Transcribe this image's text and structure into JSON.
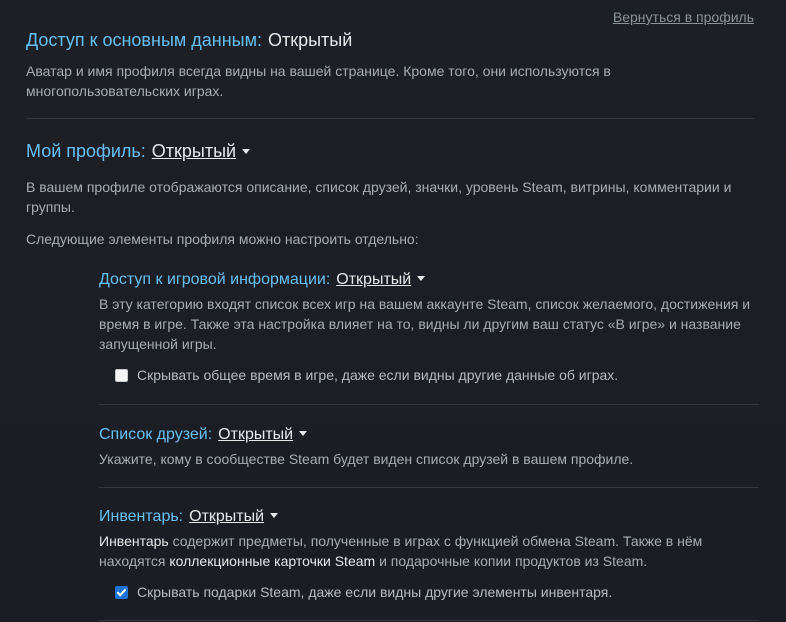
{
  "back_link": "Вернуться в профиль",
  "basic": {
    "label": "Доступ к основным данным:",
    "value": "Открытый",
    "desc": "Аватар и имя профиля всегда видны на вашей странице. Кроме того, они используются в многопользовательских играх."
  },
  "profile": {
    "label": "Мой профиль:",
    "value": "Открытый",
    "desc": "В вашем профиле отображаются описание, список друзей, значки, уровень Steam, витрины, комментарии и группы.",
    "note": "Следующие элементы профиля можно настроить отдельно:"
  },
  "game": {
    "label": "Доступ к игровой информации:",
    "value": "Открытый",
    "desc": "В эту категорию входят список всех игр на вашем аккаунте Steam, список желаемого, достижения и время в игре. Также эта настройка влияет на то, видны ли другим ваш статус «В игре» и название запущенной игры.",
    "checkbox_label": "Скрывать общее время в игре, даже если видны другие данные об играх.",
    "checkbox_checked": false
  },
  "friends": {
    "label": "Список друзей:",
    "value": "Открытый",
    "desc": "Укажите, кому в сообществе Steam будет виден список друзей в вашем профиле."
  },
  "inventory": {
    "label": "Инвентарь:",
    "value": "Открытый",
    "desc_bold1": "Инвентарь",
    "desc_part1": " содержит предметы, полученные в играх с функцией обмена Steam. Также в нём находятся ",
    "desc_bold2": "коллекционные карточки Steam",
    "desc_part2": " и подарочные копии продуктов из Steam.",
    "checkbox_label": "Скрывать подарки Steam, даже если видны другие элементы инвентаря.",
    "checkbox_checked": true
  },
  "colors": {
    "background": "#1b1e24",
    "accent": "#66c0f4",
    "text": "#a8adb4",
    "value_text": "#e6e8ea",
    "checkbox_checked": "#1e74d8"
  }
}
